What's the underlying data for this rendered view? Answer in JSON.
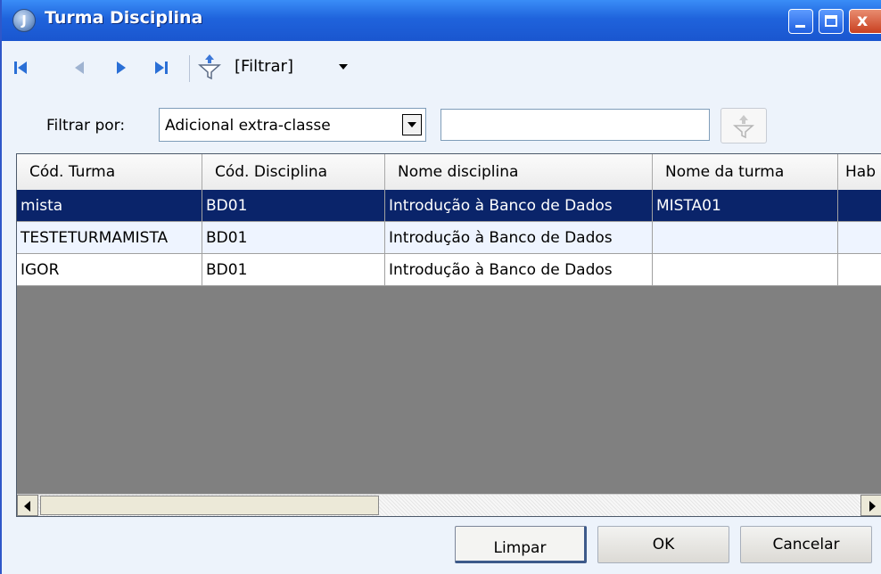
{
  "window": {
    "title": "Turma Disciplina",
    "controls": {
      "close_glyph": "x"
    }
  },
  "toolbar": {
    "filtrar_label": "[Filtrar]"
  },
  "filter": {
    "label": "Filtrar por:",
    "field": "Adicional extra-classe",
    "value": "",
    "placeholder": ""
  },
  "grid": {
    "columns": [
      "Cód. Turma",
      "Cód. Disciplina",
      "Nome disciplina",
      "Nome da turma",
      "Hab"
    ],
    "rows": [
      [
        "mista",
        "BD01",
        "Introdução à Banco de Dados",
        "MISTA01",
        ""
      ],
      [
        "TESTETURMAMISTA",
        "BD01",
        "Introdução à Banco de Dados",
        "",
        ""
      ],
      [
        "IGOR",
        "BD01",
        "Introdução à Banco de Dados",
        "",
        ""
      ]
    ],
    "selected_row": 0
  },
  "buttons": {
    "limpar": "Limpar",
    "ok": "OK",
    "cancelar": "Cancelar"
  },
  "colors": {
    "title_bar": "#1f63dc",
    "selection": "#0a246a",
    "grid_empty": "#808080"
  },
  "icons": [
    "app-icon",
    "first-record-icon",
    "previous-record-icon",
    "next-record-icon",
    "last-record-icon",
    "filter-funnel-icon",
    "dropdown-arrow-icon"
  ]
}
